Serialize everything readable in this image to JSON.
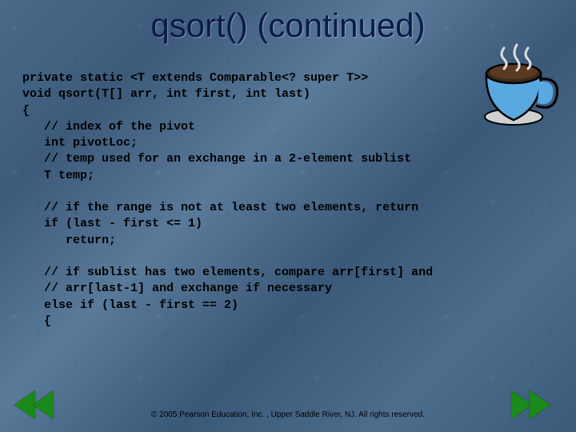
{
  "title": "qsort() (continued)",
  "code_lines": [
    "private static <T extends Comparable<? super T>>",
    "void qsort(T[] arr, int first, int last)",
    "{",
    "   // index of the pivot",
    "   int pivotLoc;",
    "   // temp used for an exchange in a 2-element sublist",
    "   T temp;",
    "",
    "   // if the range is not at least two elements, return",
    "   if (last - first <= 1)",
    "      return;",
    "",
    "   // if sublist has two elements, compare arr[first] and",
    "   // arr[last-1] and exchange if necessary",
    "   else if (last - first == 2)",
    "   {"
  ],
  "copyright": "© 2005 Pearson Education, Inc. , Upper Saddle River, NJ.  All rights reserved."
}
